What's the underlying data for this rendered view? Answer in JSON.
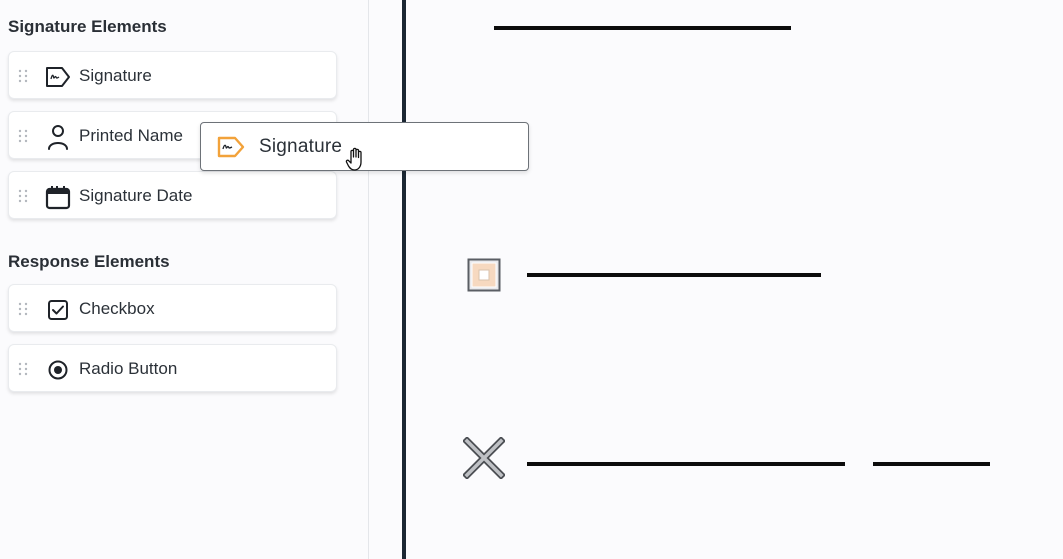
{
  "sidebar": {
    "signature_section": {
      "title": "Signature Elements",
      "items": [
        {
          "label": "Signature",
          "icon": "signature-icon"
        },
        {
          "label": "Printed Name",
          "icon": "person-icon"
        },
        {
          "label": "Signature Date",
          "icon": "calendar-icon"
        }
      ]
    },
    "response_section": {
      "title": "Response Elements",
      "items": [
        {
          "label": "Checkbox",
          "icon": "checkbox-icon"
        },
        {
          "label": "Radio Button",
          "icon": "radio-button-icon"
        }
      ]
    }
  },
  "drag_ghost": {
    "label": "Signature",
    "icon": "signature-icon"
  },
  "colors": {
    "accent": "#f2a23a",
    "checkbox_fill": "#f7d9c0",
    "document_edge": "#1b2733"
  }
}
